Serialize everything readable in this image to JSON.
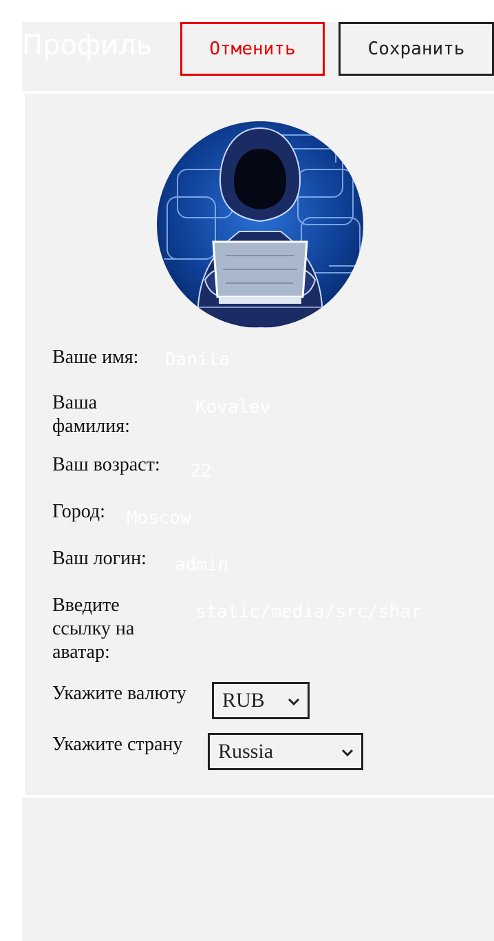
{
  "header": {
    "title": "Профиль",
    "cancel_label": "Отменить",
    "save_label": "Сохранить"
  },
  "colors": {
    "page_bg": "#f2f2f2",
    "cancel_accent": "#e60000",
    "border": "#222222",
    "avatar_bg": "#0d3a85"
  },
  "avatar": {
    "icon": "hacker-avatar"
  },
  "form": {
    "first_name": {
      "label": "Ваше имя:",
      "value": "Danila"
    },
    "last_name": {
      "label_line1": "Ваша",
      "label_line2": "фамилия:",
      "value": "Kovalev"
    },
    "age": {
      "label": "Ваш возраст:",
      "value": "22"
    },
    "city": {
      "label": "Город:",
      "value": "Moscow"
    },
    "login": {
      "label": "Ваш логин:",
      "value": "admin"
    },
    "avatar_link": {
      "label_line1": "Введите",
      "label_line2": "ссылку на",
      "label_line3": "аватар:",
      "value": "static/media/src/shar"
    },
    "currency": {
      "label": "Укажите валюту",
      "selected": "RUB"
    },
    "country": {
      "label": "Укажите страну",
      "selected": "Russia"
    }
  }
}
